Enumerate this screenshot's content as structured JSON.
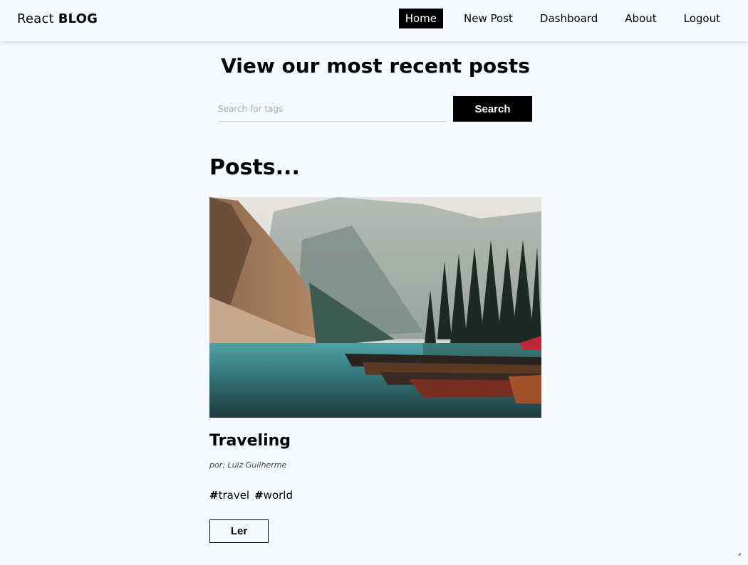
{
  "navbar": {
    "brand_regular": "React ",
    "brand_bold": "BLOG",
    "links": [
      {
        "label": "Home",
        "active": true
      },
      {
        "label": "New Post",
        "active": false
      },
      {
        "label": "Dashboard",
        "active": false
      },
      {
        "label": "About",
        "active": false
      },
      {
        "label": "Logout",
        "active": false
      }
    ]
  },
  "hero": {
    "title": "View our most recent posts"
  },
  "search": {
    "placeholder": "Search for tags",
    "value": "",
    "button_label": "Search"
  },
  "posts_section": {
    "heading": "Posts..."
  },
  "posts": [
    {
      "image": "mountain-lake-photo",
      "title": "Traveling",
      "author": "por: Luiz Guilherme",
      "tags": [
        {
          "hash": "#",
          "name": "travel"
        },
        {
          "hash": "#",
          "name": "world"
        }
      ],
      "read_label": "Ler"
    }
  ],
  "colors": {
    "background": "#f4faff",
    "accent": "#000000",
    "nav_active_text": "#ffffff"
  }
}
